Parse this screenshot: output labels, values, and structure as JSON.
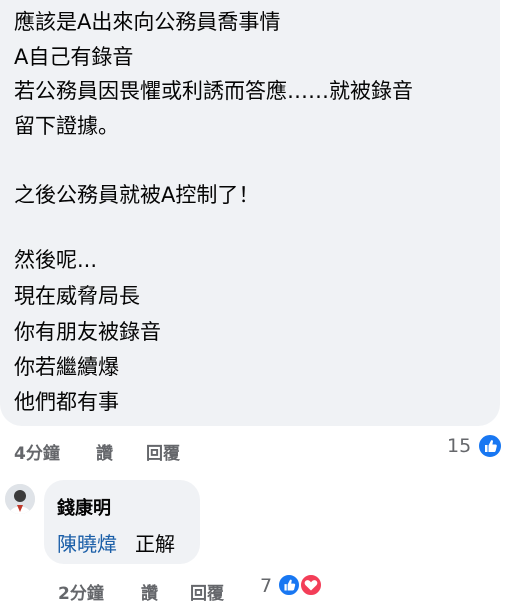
{
  "comment": {
    "lines": [
      "應該是A出來向公務員喬事情",
      "A自己有錄音",
      "若公務員因畏懼或利誘而答應……就被錄音",
      "留下證據。",
      "",
      "之後公務員就被A控制了！",
      "",
      "然後呢...",
      "現在威脅局長",
      "你有朋友被錄音",
      "你若繼續爆",
      "他們都有事"
    ],
    "time": "4分鐘",
    "like_label": "讚",
    "reply_label": "回覆",
    "reaction_count": "15",
    "reaction_icons": [
      "like-icon"
    ]
  },
  "reply": {
    "author": "錢康明",
    "mention": "陳曉煒",
    "text": "正解",
    "time": "2分鐘",
    "like_label": "讚",
    "reply_label": "回覆",
    "reaction_count": "7",
    "reaction_icons": [
      "like-icon",
      "love-icon"
    ]
  },
  "colors": {
    "bubble": "#f0f2f5",
    "meta_text": "#65676b",
    "mention": "#1b5fa8",
    "like_blue": "#1877f2",
    "love_red": "#f33e58"
  }
}
